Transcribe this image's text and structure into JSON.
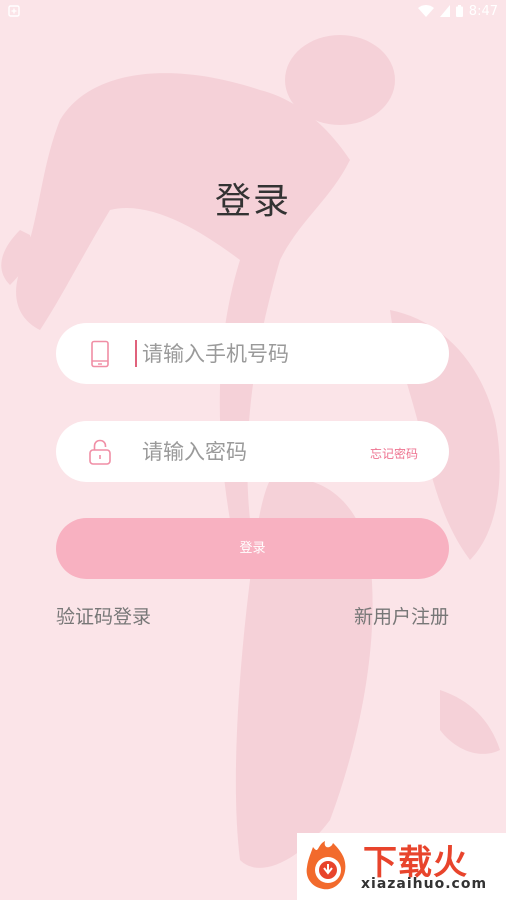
{
  "status_bar": {
    "time": "8:47"
  },
  "page": {
    "title": "登录"
  },
  "form": {
    "phone_placeholder": "请输入手机号码",
    "password_placeholder": "请输入密码",
    "forgot_password_label": "忘记密码",
    "login_button_label": "登录"
  },
  "links": {
    "sms_login_label": "验证码登录",
    "register_label": "新用户注册"
  },
  "watermark": {
    "brand": "下载火",
    "url": "xiazaihuo.com"
  },
  "colors": {
    "background": "#fbe4e8",
    "accent": "#ee7390",
    "button": "#f8b1c1"
  }
}
